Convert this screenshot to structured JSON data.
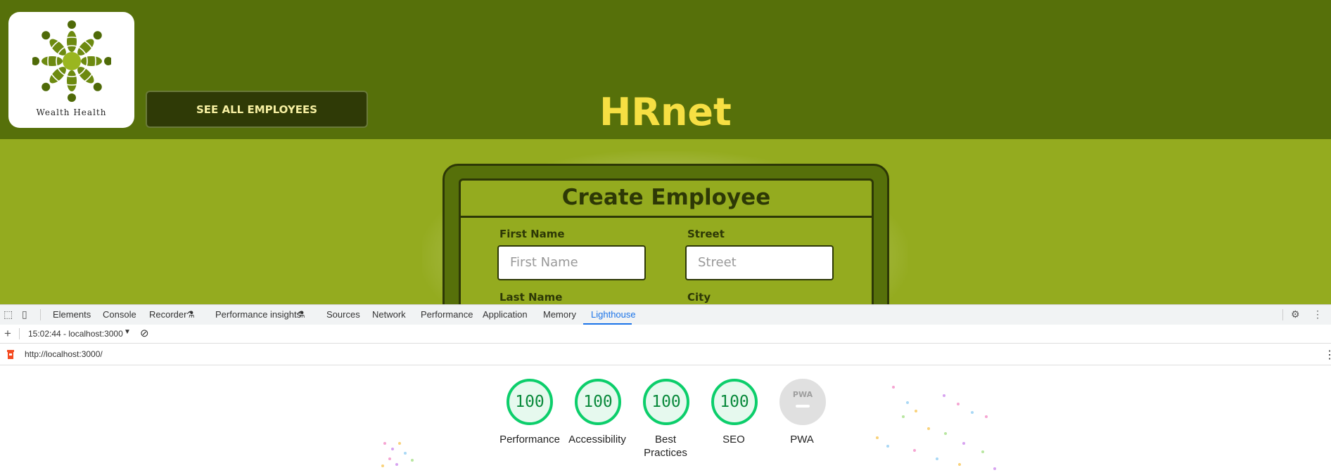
{
  "app": {
    "brand": {
      "logo_text": "Wealth Health"
    },
    "nav": {
      "see_all_label": "SEE ALL EMPLOYEES"
    },
    "title": "HRnet",
    "form": {
      "heading": "Create Employee",
      "fields": [
        {
          "label": "First Name",
          "placeholder": "First Name"
        },
        {
          "label": "Street",
          "placeholder": "Street"
        },
        {
          "label": "Last Name"
        },
        {
          "label": "City"
        }
      ]
    }
  },
  "devtools": {
    "tabs": [
      {
        "label": "Elements"
      },
      {
        "label": "Console"
      },
      {
        "label": "Recorder"
      },
      {
        "label": "Performance insights"
      },
      {
        "label": "Sources"
      },
      {
        "label": "Network"
      },
      {
        "label": "Performance"
      },
      {
        "label": "Application"
      },
      {
        "label": "Memory"
      },
      {
        "label": "Lighthouse",
        "active": true
      }
    ],
    "report_selector": "15:02:44 - localhost:3000",
    "url": "http://localhost:3000/",
    "scores": [
      {
        "label": "Performance",
        "value": "100"
      },
      {
        "label": "Accessibility",
        "value": "100"
      },
      {
        "label": "Best Practices",
        "value": "100"
      },
      {
        "label": "SEO",
        "value": "100"
      },
      {
        "label": "PWA",
        "value": "PWA"
      }
    ]
  },
  "colors": {
    "header": "#56700a",
    "background": "#94ab1f",
    "title": "#f6df43",
    "score_pass": "#0cce6b",
    "devtools_accent": "#1a73e8"
  }
}
